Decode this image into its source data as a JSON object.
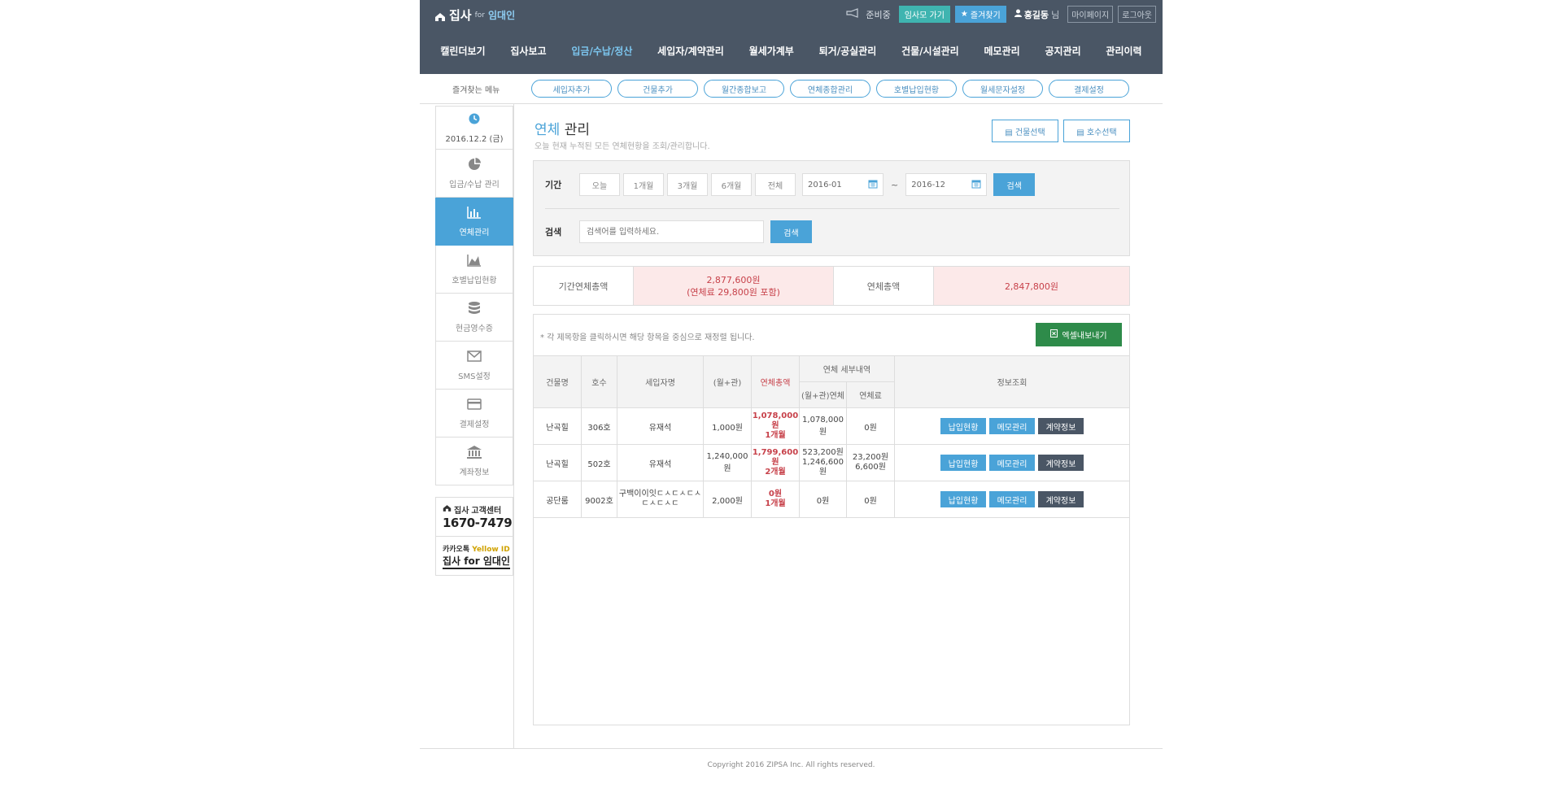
{
  "header": {
    "logo_main": "집사",
    "logo_for": "for",
    "logo_sub": "임대인",
    "status_text": "준비중",
    "go_button": "임사모 가기",
    "fav_button": "즐겨찾기",
    "user_name": "홍길동",
    "user_suffix": "님",
    "mypage_button": "마이페이지",
    "logout_button": "로그아웃"
  },
  "nav": {
    "items": [
      "캘린더보기",
      "집사보고",
      "입금/수납/정산",
      "세입자/계약관리",
      "월세가계부",
      "퇴거/공실관리",
      "건물/시설관리",
      "메모관리",
      "공지관리",
      "관리이력"
    ]
  },
  "favorites": {
    "label": "즐겨찾는 메뉴",
    "items": [
      "세입자추가",
      "건물추가",
      "월간종합보고",
      "연체종합관리",
      "호별납입현황",
      "월세문자설정",
      "결제설정"
    ]
  },
  "sidebar": {
    "date": "2016.12.2 (금)",
    "items": [
      "입금/수납 관리",
      "연체관리",
      "호별납입현황",
      "현금영수증",
      "SMS설정",
      "결제설정",
      "계좌정보"
    ],
    "cs_brand": "집사",
    "cs_label": "고객센터",
    "cs_phone": "1670-7479",
    "kakao_label": "카카오톡",
    "kakao_yellow": "Yellow ID",
    "kakao_name": "집사 for 임대인"
  },
  "page": {
    "title_hl": "연체",
    "title_rest": "관리",
    "subtitle": "오늘 현재 누적된 모든 연체현황을 조회/관리합니다.",
    "building_select": "건물선택",
    "unit_select": "호수선택"
  },
  "filter": {
    "period_label": "기간",
    "period_options": [
      "오늘",
      "1개월",
      "3개월",
      "6개월",
      "전체"
    ],
    "date_from": "2016-01",
    "date_sep": "~",
    "date_to": "2016-12",
    "search_button": "검색",
    "search_label": "검색",
    "search_placeholder": "검색어를 입력하세요.",
    "search_button2": "검색"
  },
  "totals": {
    "period_label": "기간연체총액",
    "period_value": "2,877,600원",
    "period_value2": "(연체료 29,800원 포함)",
    "total_label": "연체총액",
    "total_value": "2,847,800원"
  },
  "table": {
    "note": "* 각 제목항을 클릭하시면 해당 항목을 중심으로 재정렬 됩니다.",
    "excel_button": "엑셀내보내기",
    "headers": {
      "building": "건물명",
      "unit": "호수",
      "tenant": "세입자명",
      "rent": "(월+관)",
      "overdue": "연체총액",
      "detail": "연체 세부내역",
      "detail_rent": "(월+관)연체",
      "detail_fee": "연체료",
      "info": "정보조회"
    },
    "rows": [
      {
        "building": "난곡힐",
        "unit": "306호",
        "tenant": "유재석",
        "rent": "1,000원",
        "overdue": "1,078,000원",
        "overdue_months": "1개월",
        "detail_rent": "1,078,000원",
        "detail_rent2": "",
        "detail_fee": "0원",
        "detail_fee2": ""
      },
      {
        "building": "난곡힐",
        "unit": "502호",
        "tenant": "유재석",
        "rent": "1,240,000원",
        "overdue": "1,799,600원",
        "overdue_months": "2개월",
        "detail_rent": "523,200원",
        "detail_rent2": "1,246,600원",
        "detail_fee": "23,200원",
        "detail_fee2": "6,600원"
      },
      {
        "building": "공단룸",
        "unit": "9002호",
        "tenant": "구백이이잇ㄷㅅㄷㅅㄷㅅ",
        "tenant2": "ㄷㅅㄷㅅㄷ",
        "rent": "2,000원",
        "overdue": "0원",
        "overdue_months": "1개월",
        "detail_rent": "0원",
        "detail_rent2": "",
        "detail_fee": "0원",
        "detail_fee2": ""
      }
    ],
    "action_labels": {
      "pay": "납입현황",
      "memo": "메모관리",
      "contract": "계약정보"
    }
  },
  "footer": {
    "copyright": "Copyright 2016 ZIPSA Inc. All rights reserved."
  },
  "colors": {
    "header_bg": "#4a5665",
    "accent": "#4aa3d8",
    "overdue_red": "#c7414a",
    "excel_green": "#2e8b4a"
  }
}
